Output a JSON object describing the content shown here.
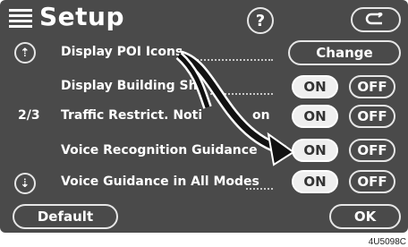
{
  "title": "Setup",
  "help_label": "?",
  "back_icon": "back-arrow-icon",
  "items": [
    {
      "label": "Display POI Icons",
      "control": "Change"
    },
    {
      "label": "Display Building Sh",
      "on": "ON",
      "off": "OFF"
    },
    {
      "label": "Traffic Restrict. Noti",
      "label_tail": "on",
      "on": "ON",
      "off": "OFF"
    },
    {
      "label": "Voice Recognition Guidance",
      "on": "ON",
      "off": "OFF"
    },
    {
      "label": "Voice Guidance in All Modes",
      "on": "ON",
      "off": "OFF"
    }
  ],
  "page_indicator": "2/3",
  "default_label": "Default",
  "ok_label": "OK",
  "watermark": "4U5098C"
}
